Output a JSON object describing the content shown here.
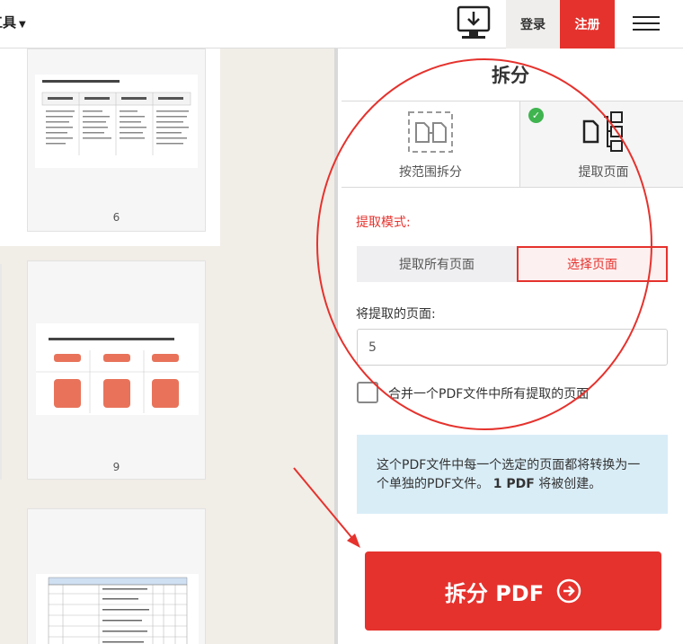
{
  "topbar": {
    "tools_label": "工具",
    "login_label": "登录",
    "register_label": "注册"
  },
  "canvas": {
    "pages": [
      {
        "page_number": "6"
      },
      {
        "page_number": "9"
      }
    ]
  },
  "panel": {
    "title": "拆分",
    "tabs": [
      {
        "label": "按范围拆分",
        "icon": "range-split-icon"
      },
      {
        "label": "提取页面",
        "icon": "extract-pages-icon",
        "selected": true
      }
    ],
    "mode_label": "提取模式:",
    "mode_options": [
      {
        "label": "提取所有页面"
      },
      {
        "label": "选择页面",
        "selected": true
      }
    ],
    "pages_label": "将提取的页面:",
    "pages_value": "5",
    "merge_label": "合并一个PDF文件中所有提取的页面",
    "info_text_1": "这个PDF文件中每一个选定的页面都将转换为一个单独的PDF文件。",
    "info_count": "1 PDF",
    "info_text_2": "将被创建。",
    "split_button_label": "拆分 PDF"
  },
  "colors": {
    "accent": "#e5322d",
    "success": "#3fb44f",
    "info_bg": "#d9edf7"
  }
}
